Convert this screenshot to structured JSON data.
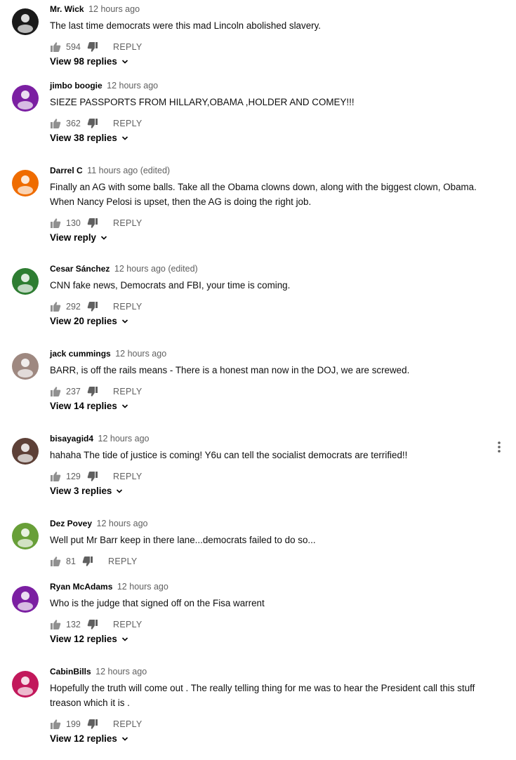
{
  "reply_label": "REPLY",
  "comments": [
    {
      "author": "Mr. Wick",
      "time": "12 hours ago",
      "text": "The last time democrats were this mad Lincoln abolished slavery.",
      "likes": "594",
      "view_replies": "View 98 replies",
      "avatar_color": "#1a1a1a"
    },
    {
      "author": "jimbo boogie",
      "time": "12 hours ago",
      "text": "SIEZE PASSPORTS FROM HILLARY,OBAMA ,HOLDER AND COMEY!!!",
      "likes": "362",
      "view_replies": "View 38 replies",
      "avatar_color": "#7b1fa2"
    },
    {
      "author": "Darrel C",
      "time": "11 hours ago (edited)",
      "text": "Finally an AG with some balls.  Take all the Obama clowns down, along with the biggest clown, Obama. When Nancy Pelosi is upset, then the AG is doing the right job.",
      "likes": "130",
      "view_replies": "View reply",
      "avatar_color": "#ef6c00"
    },
    {
      "author": "Cesar Sánchez",
      "time": "12 hours ago (edited)",
      "text": "CNN fake news, Democrats and FBI, your time is coming.",
      "likes": "292",
      "view_replies": "View 20 replies",
      "avatar_color": "#2e7d32"
    },
    {
      "author": "jack cummings",
      "time": "12 hours ago",
      "text": "BARR, is off the rails means - There is a honest man now in the DOJ, we are screwed.",
      "likes": "237",
      "view_replies": "View 14 replies",
      "avatar_color": "#9e8880"
    },
    {
      "author": "bisayagid4",
      "time": "12 hours ago",
      "text": "hahaha The tide of justice is coming! Y6u can tell the socialist democrats are terrified!!",
      "likes": "129",
      "view_replies": "View 3 replies",
      "avatar_color": "#5d4037"
    },
    {
      "author": "Dez Povey",
      "time": "12 hours ago",
      "text": "Well put Mr Barr keep in there lane...democrats failed to do so...",
      "likes": "81",
      "view_replies": "",
      "avatar_color": "#689f38"
    },
    {
      "author": "Ryan McAdams",
      "time": "12 hours ago",
      "text": "Who is the judge that signed off on the Fisa warrent",
      "likes": "132",
      "view_replies": "View 12 replies",
      "avatar_color": "#7b1fa2"
    },
    {
      "author": "CabinBills",
      "time": "12 hours ago",
      "text": "Hopefully the truth will come out . The really telling thing for me was to hear the President call this stuff treason which it is .",
      "likes": "199",
      "view_replies": "View 12 replies",
      "avatar_color": "#c2185b"
    }
  ]
}
